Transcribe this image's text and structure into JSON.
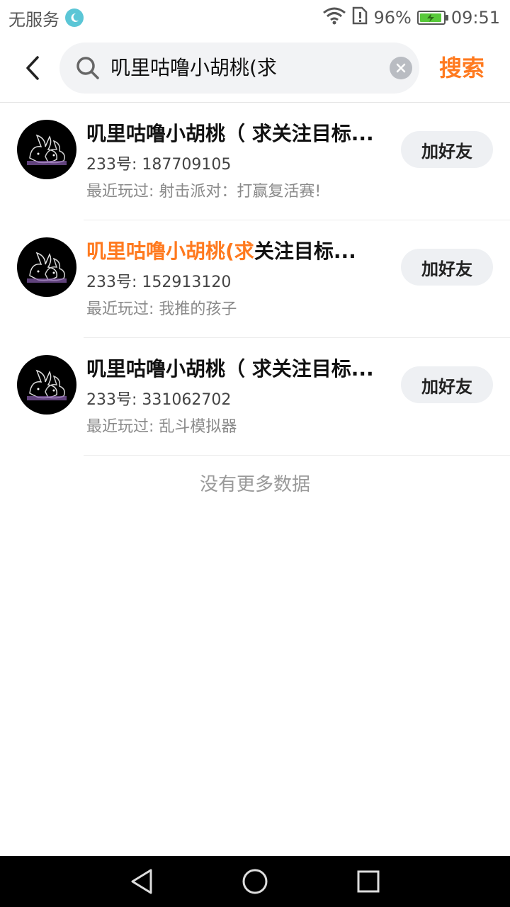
{
  "status_bar": {
    "carrier": "无服务",
    "battery_percent": "96%",
    "battery_level": 0.96,
    "time": "09:51"
  },
  "search": {
    "query": "叽里咕噜小胡桃(求",
    "submit_label": "搜索"
  },
  "results": [
    {
      "name_prefix": "",
      "name_highlight": "",
      "name_rest": "叽里咕噜小胡桃（ 求关注目标...",
      "id_text": "233号: 187709105",
      "recent_text": "最近玩过: 射击派对：打赢复活赛!",
      "add_label": "加好友"
    },
    {
      "name_prefix": "",
      "name_highlight": "叽里咕噜小胡桃(求",
      "name_rest": "关注目标...",
      "id_text": "233号: 152913120",
      "recent_text": "最近玩过: 我推的孩子",
      "add_label": "加好友"
    },
    {
      "name_prefix": "",
      "name_highlight": "",
      "name_rest": "叽里咕噜小胡桃（ 求关注目标...",
      "id_text": "233号: 331062702",
      "recent_text": "最近玩过: 乱斗模拟器",
      "add_label": "加好友"
    }
  ],
  "footer_text": "没有更多数据",
  "colors": {
    "accent": "#ff7a1f",
    "battery": "#58c93a"
  },
  "icons": {
    "moon": "moon-icon",
    "wifi": "wifi-icon",
    "sim": "sim-alert-icon",
    "back": "chevron-left-icon",
    "search": "search-icon",
    "clear": "clear-icon",
    "nav_back": "triangle-back-icon",
    "nav_home": "circle-home-icon",
    "nav_recent": "square-recent-icon"
  }
}
